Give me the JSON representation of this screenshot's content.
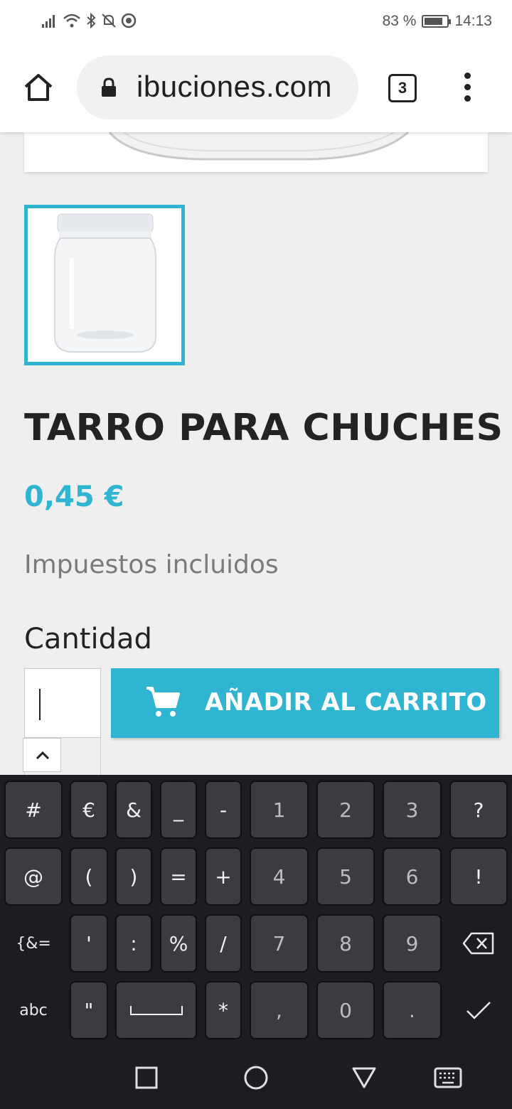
{
  "status_bar": {
    "battery": "83 %",
    "battery_level": 0.83,
    "time": "14:13"
  },
  "browser": {
    "url": "ibuciones.com",
    "tab_count": "3"
  },
  "product": {
    "title": "TARRO PARA CHUCHES",
    "price": "0,45 €",
    "tax_note": "Impuestos incluidos",
    "quantity_label": "Cantidad",
    "quantity_value": "",
    "add_to_cart_label": "AÑADIR AL CARRITO"
  },
  "colors": {
    "accent": "#2fb5d2",
    "keyboard_bg": "#1b1d22",
    "key_bg": "#3a3c42"
  },
  "keyboard": {
    "row1": [
      "#",
      "€",
      "&",
      "_",
      "-",
      "1",
      "2",
      "3",
      "?"
    ],
    "row2": [
      "@",
      "(",
      ")",
      "=",
      "+",
      "4",
      "5",
      "6",
      "!"
    ],
    "row3": [
      "{&=",
      "'",
      ":",
      "%",
      "/",
      "7",
      "8",
      "9"
    ],
    "row4": [
      "abc",
      "\"",
      "*",
      ",",
      "0",
      "."
    ]
  },
  "icons": {
    "home": "home-icon",
    "lock": "lock-icon",
    "menu": "more-vert-icon",
    "cart": "shopping-cart-icon",
    "backspace": "backspace-icon",
    "enter": "checkmark-icon"
  }
}
